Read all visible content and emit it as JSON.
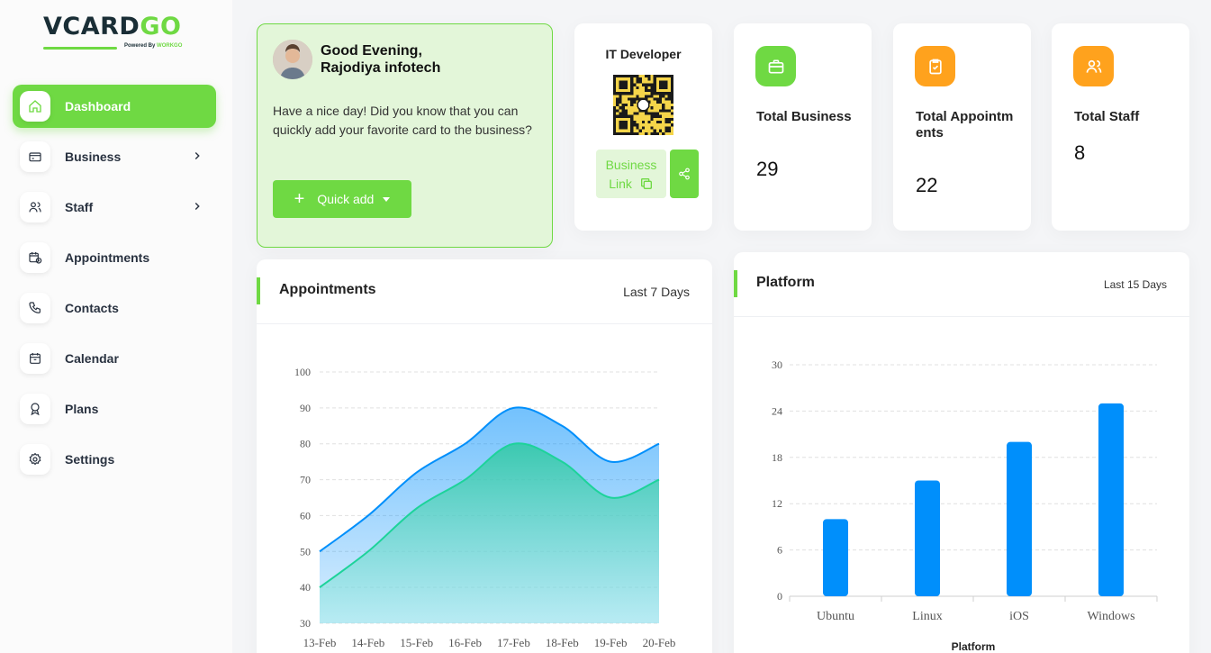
{
  "brand": {
    "name_part1": "VCARD",
    "name_part2": "GO",
    "powered_by": "Powered By",
    "powered_brand": "WORKGO"
  },
  "sidebar": {
    "items": [
      {
        "label": "Dashboard",
        "icon": "home-icon",
        "active": true
      },
      {
        "label": "Business",
        "icon": "card-icon",
        "has_submenu": true
      },
      {
        "label": "Staff",
        "icon": "users-icon",
        "has_submenu": true
      },
      {
        "label": "Appointments",
        "icon": "calendar-clock-icon"
      },
      {
        "label": "Contacts",
        "icon": "phone-icon"
      },
      {
        "label": "Calendar",
        "icon": "calendar-icon"
      },
      {
        "label": "Plans",
        "icon": "award-icon"
      },
      {
        "label": "Settings",
        "icon": "gear-icon"
      }
    ]
  },
  "welcome": {
    "greeting": "Good Evening,",
    "name": "Rajodiya infotech",
    "message": "Have a nice day! Did you know that you can quickly add your favorite card to the business?",
    "quick_add": "Quick add"
  },
  "qr_card": {
    "title": "IT Developer",
    "link_label_1": "Business",
    "link_label_2": "Link"
  },
  "stats": [
    {
      "label": "Total Business",
      "value": "29",
      "icon": "briefcase-icon",
      "color": "#6fd943"
    },
    {
      "label": "Total Appointments",
      "value": "22",
      "icon": "clipboard-check-icon",
      "color": "#ffa21d"
    },
    {
      "label": "Total Staff",
      "value": "8",
      "icon": "users-icon",
      "color": "#ffa21d"
    }
  ],
  "appointments_chart": {
    "title": "Appointments",
    "range": "Last 7 Days"
  },
  "platform_chart": {
    "title": "Platform",
    "range": "Last 15 Days"
  },
  "colors": {
    "accent": "#6fd943",
    "warning": "#ffa21d",
    "blue": "#008ffb",
    "teal": "#00e396"
  },
  "chart_data": [
    {
      "type": "area",
      "categories": [
        "13-Feb",
        "14-Feb",
        "15-Feb",
        "16-Feb",
        "17-Feb",
        "18-Feb",
        "19-Feb",
        "20-Feb"
      ],
      "series": [
        {
          "values": [
            50,
            60,
            72,
            80,
            90,
            85,
            75,
            80
          ]
        },
        {
          "values": [
            40,
            50,
            62,
            70,
            80,
            75,
            65,
            70
          ]
        }
      ],
      "ylim": [
        30,
        100
      ],
      "yticks": [
        30,
        40,
        50,
        60,
        70,
        80,
        90,
        100
      ],
      "grid": true
    },
    {
      "type": "bar",
      "categories": [
        "Ubuntu",
        "Linux",
        "iOS",
        "Windows"
      ],
      "values": [
        10,
        15,
        20,
        25
      ],
      "xlabel": "Platform",
      "ylim": [
        0,
        30
      ],
      "yticks": [
        0,
        6,
        12,
        18,
        24,
        30
      ],
      "grid": true
    }
  ]
}
